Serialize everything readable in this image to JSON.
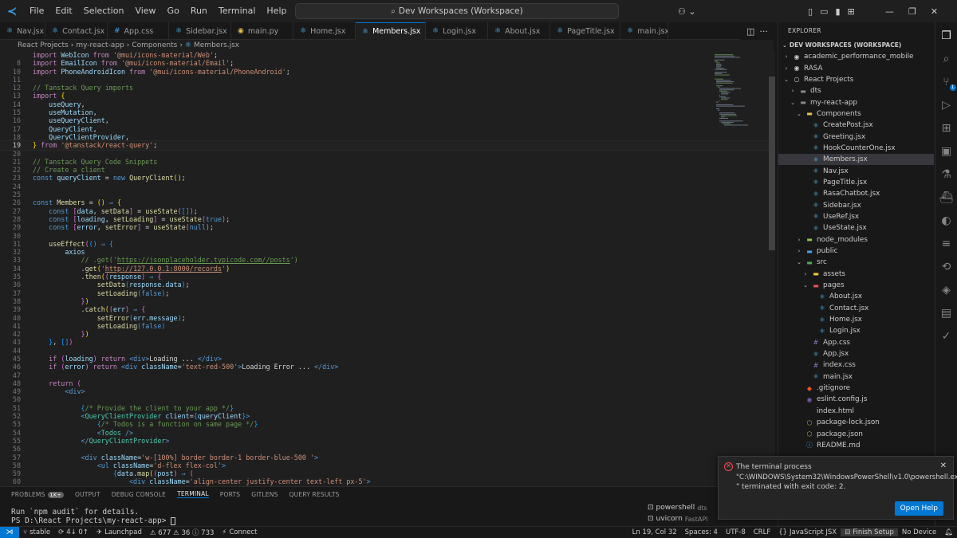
{
  "titlebar": {
    "menus": [
      "File",
      "Edit",
      "Selection",
      "View",
      "Go",
      "Run",
      "Terminal",
      "Help"
    ],
    "command_center": "Dev Workspaces (Workspace)"
  },
  "tabs": [
    {
      "label": "Nav.jsx",
      "icon": "react-icon",
      "active": false
    },
    {
      "label": "Contact.jsx",
      "icon": "react-icon",
      "active": false
    },
    {
      "label": "App.css",
      "icon": "css-icon",
      "active": false
    },
    {
      "label": "Sidebar.jsx",
      "icon": "react-icon",
      "active": false
    },
    {
      "label": "main.py",
      "icon": "python-icon",
      "active": false
    },
    {
      "label": "Home.jsx",
      "icon": "react-icon",
      "active": false
    },
    {
      "label": "Members.jsx",
      "icon": "react-icon",
      "active": true,
      "modified": true
    },
    {
      "label": "Login.jsx",
      "icon": "react-icon",
      "active": false
    },
    {
      "label": "About.jsx",
      "icon": "react-icon",
      "active": false
    },
    {
      "label": "PageTitle.jsx",
      "icon": "react-icon",
      "active": false
    },
    {
      "label": "main.jsx",
      "icon": "react-icon",
      "active": false
    }
  ],
  "breadcrumb": [
    "React Projects",
    "my-react-app",
    "Components",
    "Members.jsx"
  ],
  "editor": {
    "current_line": 19,
    "lines": [
      {
        "n": "",
        "h": "<span class='kw'>import</span> <span class='id'>WebIcon</span> <span class='kw'>from</span> <span class='st'>'@mui/icons-material/Web'</span>;"
      },
      {
        "n": "8",
        "h": "<span class='kw'>import</span> <span class='id'>EmailIcon</span> <span class='kw'>from</span> <span class='st'>'@mui/icons-material/Email'</span>;"
      },
      {
        "n": "10",
        "h": "<span class='kw'>import</span> <span class='id'>PhoneAndroidIcon</span> <span class='kw'>from</span> <span class='st'>'@mui/icons-material/PhoneAndroid'</span>;"
      },
      {
        "n": "11",
        "h": ""
      },
      {
        "n": "12",
        "h": "<span class='cm'>// Tanstack Query imports</span>"
      },
      {
        "n": "13",
        "h": "<span class='kw'>import</span> <span class='br1'>{</span>"
      },
      {
        "n": "14",
        "h": "    <span class='id'>useQuery</span>,"
      },
      {
        "n": "15",
        "h": "    <span class='id'>useMutation</span>,"
      },
      {
        "n": "16",
        "h": "    <span class='id'>useQueryClient</span>,"
      },
      {
        "n": "17",
        "h": "    <span class='id'>QueryClient</span>,"
      },
      {
        "n": "18",
        "h": "    <span class='id'>QueryClientProvider</span>,"
      },
      {
        "n": "19",
        "h": "<span class='br1'>}</span> <span class='kw'>from</span> <span class='st'>'@tanstack/react-query'</span>;"
      },
      {
        "n": "20",
        "h": ""
      },
      {
        "n": "21",
        "h": "<span class='cm'>// Tanstack Query Code Snippets</span>"
      },
      {
        "n": "22",
        "h": "<span class='cm'>// Create a client</span>"
      },
      {
        "n": "23",
        "h": "<span class='kw2'>const</span> <span class='id'>queryClient</span> = <span class='kw2'>new</span> <span class='fn'>QueryClient</span><span class='br1'>()</span>;"
      },
      {
        "n": "24",
        "h": ""
      },
      {
        "n": "25",
        "h": ""
      },
      {
        "n": "26",
        "h": "<span class='kw2'>const</span> <span class='fn'>Members</span> = <span class='br1'>()</span> <span class='kw2'>⇒</span> <span class='br1'>{</span>"
      },
      {
        "n": "27",
        "h": "    <span class='kw2'>const</span> <span class='br2'>[</span><span class='id'>data</span>, <span class='fn'>setData</span><span class='br2'>]</span> = <span class='fn'>useState</span><span class='br2'>(</span><span class='br3'>[]</span><span class='br2'>)</span>;"
      },
      {
        "n": "28",
        "h": "    <span class='kw2'>const</span> <span class='br2'>[</span><span class='id'>loading</span>, <span class='fn'>setLoading</span><span class='br2'>]</span> = <span class='fn'>useState</span><span class='br2'>(</span><span class='kw2'>true</span><span class='br2'>)</span>;"
      },
      {
        "n": "29",
        "h": "    <span class='kw2'>const</span> <span class='br2'>[</span><span class='id'>error</span>, <span class='fn'>setError</span><span class='br2'>]</span> = <span class='fn'>useState</span><span class='br2'>(</span><span class='kw2'>null</span><span class='br2'>)</span>;"
      },
      {
        "n": "30",
        "h": ""
      },
      {
        "n": "31",
        "h": "    <span class='fn'>useEffect</span><span class='br2'>(</span><span class='br3'>()</span> <span class='kw2'>⇒</span> <span class='br3'>{</span>"
      },
      {
        "n": "32",
        "h": "        <span class='id'>axios</span>"
      },
      {
        "n": "33",
        "h": "            <span class='cm'>// .get('<span class='ul'>https://jsonplaceholder.typicode.com//posts</span>')</span>"
      },
      {
        "n": "34",
        "h": "            .<span class='fn'>get</span><span class='br1'>(</span><span class='st'>'<span class='ul'>http://127.0.0.1:8000/records</span>'</span><span class='br1'>)</span>"
      },
      {
        "n": "35",
        "h": "            .<span class='fn'>then</span><span class='br1'>(</span><span class='br2'>(</span><span class='id'>response</span><span class='br2'>)</span> <span class='kw2'>⇒</span> <span class='br2'>{</span>"
      },
      {
        "n": "36",
        "h": "                <span class='fn'>setData</span><span class='br3'>(</span><span class='id'>response</span>.<span class='id'>data</span><span class='br3'>)</span>;"
      },
      {
        "n": "37",
        "h": "                <span class='fn'>setLoading</span><span class='br3'>(</span><span class='kw2'>false</span><span class='br3'>)</span>;"
      },
      {
        "n": "38",
        "h": "            <span class='br2'>}</span><span class='br1'>)</span>"
      },
      {
        "n": "39",
        "h": "            .<span class='fn'>catch</span><span class='br1'>(</span><span class='br2'>(</span><span class='id'>err</span><span class='br2'>)</span> <span class='kw2'>⇒</span> <span class='br2'>{</span>"
      },
      {
        "n": "40",
        "h": "                <span class='fn'>setError</span><span class='br3'>(</span><span class='id'>err</span>.<span class='id'>message</span><span class='br3'>)</span>;"
      },
      {
        "n": "41",
        "h": "                <span class='fn'>setLoading</span><span class='br3'>(</span><span class='kw2'>false</span><span class='br3'>)</span>"
      },
      {
        "n": "42",
        "h": "            <span class='br2'>}</span><span class='br1'>)</span>"
      },
      {
        "n": "43",
        "h": "    <span class='br3'>}</span>, <span class='br3'>[]</span><span class='br2'>)</span>"
      },
      {
        "n": "44",
        "h": ""
      },
      {
        "n": "45",
        "h": "    <span class='kw'>if</span> <span class='br2'>(</span><span class='id'>loading</span><span class='br2'>)</span> <span class='kw'>return</span> <span class='tag'>&lt;div&gt;</span>Loading ... <span class='tag'>&lt;/div&gt;</span>"
      },
      {
        "n": "46",
        "h": "    <span class='kw'>if</span> <span class='br2'>(</span><span class='id'>error</span><span class='br2'>)</span> <span class='kw'>return</span> <span class='tag'>&lt;div</span> <span class='at'>className</span>=<span class='st'>'text-red-500'</span><span class='tag'>&gt;</span>Loading Error ... <span class='tag'>&lt;/div&gt;</span>"
      },
      {
        "n": "47",
        "h": ""
      },
      {
        "n": "48",
        "h": "    <span class='kw'>return</span> <span class='br2'>(</span>"
      },
      {
        "n": "49",
        "h": "        <span class='tag'>&lt;div&gt;</span>"
      },
      {
        "n": "50",
        "h": ""
      },
      {
        "n": "51",
        "h": "            <span class='br3'>{</span><span class='cm'>/* Provide the client to your app */</span><span class='br3'>}</span>"
      },
      {
        "n": "52",
        "h": "            <span class='tag'>&lt;</span><span class='ty'>QueryClientProvider</span> <span class='at'>client</span>=<span class='br3'>{</span><span class='id'>queryClient</span><span class='br3'>}</span><span class='tag'>&gt;</span>"
      },
      {
        "n": "53",
        "h": "                <span class='br3'>{</span><span class='cm'>/* Todos is a function on same page */</span><span class='br3'>}</span>"
      },
      {
        "n": "54",
        "h": "                <span class='tag'>&lt;</span><span class='ty'>Todos</span> <span class='tag'>/&gt;</span>"
      },
      {
        "n": "55",
        "h": "            <span class='tag'>&lt;/</span><span class='ty'>QueryClientProvider</span><span class='tag'>&gt;</span>"
      },
      {
        "n": "56",
        "h": ""
      },
      {
        "n": "57",
        "h": "            <span class='tag'>&lt;div</span> <span class='at'>className</span>=<span class='st'>'w-[100%] border border-1 border-blue-500 '</span><span class='tag'>&gt;</span>"
      },
      {
        "n": "58",
        "h": "                <span class='tag'>&lt;ul</span> <span class='at'>className</span>=<span class='st'>'d-flex flex-col'</span><span class='tag'>&gt;</span>"
      },
      {
        "n": "59",
        "h": "                    <span class='br3'>{</span><span class='id'>data</span>.<span class='fn'>map</span><span class='br1'>(</span><span class='br2'>(</span><span class='id'>post</span><span class='br2'>)</span> <span class='kw2'>⇒</span> <span class='br2'>(</span>"
      },
      {
        "n": "60",
        "h": "                        <span class='tag'>&lt;div</span> <span class='at'>className</span>=<span class='st'>'align-center justify-center text-left px-5'</span><span class='tag'>&gt;</span>"
      }
    ]
  },
  "panel": {
    "tabs": [
      {
        "label": "PROBLEMS",
        "badge": "1K+"
      },
      {
        "label": "OUTPUT"
      },
      {
        "label": "DEBUG CONSOLE"
      },
      {
        "label": "TERMINAL",
        "active": true
      },
      {
        "label": "PORTS"
      },
      {
        "label": "GITLENS"
      },
      {
        "label": "QUERY RESULTS"
      }
    ],
    "terminal_lines": [
      "Run `npm audit` for details.",
      "PS D:\\React Projects\\my-react-app> "
    ],
    "terminals": [
      {
        "name": "powershell",
        "sub": "dts"
      },
      {
        "name": "uvicorn",
        "sub": "FastAPI"
      }
    ]
  },
  "explorer": {
    "header": "EXPLORER",
    "section": "DEV WORKSPACES (WORKSPACE)",
    "rows": [
      {
        "label": "academic_performance_mobile",
        "depth": 0,
        "chev": "›",
        "icon": "◉",
        "color": "#cccccc"
      },
      {
        "label": "RASA",
        "depth": 0,
        "chev": "›",
        "icon": "◉",
        "color": "#cccccc"
      },
      {
        "label": "React Projects",
        "depth": 0,
        "chev": "⌄",
        "icon": "○",
        "color": "#cccccc"
      },
      {
        "label": "dts",
        "depth": 1,
        "chev": "›",
        "icon": "▬",
        "color": "#8a8a8a"
      },
      {
        "label": "my-react-app",
        "depth": 1,
        "chev": "⌄",
        "icon": "▬",
        "color": "#8a8a8a"
      },
      {
        "label": "Components",
        "depth": 2,
        "chev": "⌄",
        "icon": "▬",
        "color": "#e8c34b"
      },
      {
        "label": "CreatePost.jsx",
        "depth": 3,
        "chev": "",
        "icon": "⚛",
        "color": "#4fc1ff"
      },
      {
        "label": "Greeting.jsx",
        "depth": 3,
        "chev": "",
        "icon": "⚛",
        "color": "#4fc1ff"
      },
      {
        "label": "HookCounterOne.jsx",
        "depth": 3,
        "chev": "",
        "icon": "⚛",
        "color": "#4fc1ff"
      },
      {
        "label": "Members.jsx",
        "depth": 3,
        "chev": "",
        "icon": "⚛",
        "color": "#4fc1ff",
        "selected": true
      },
      {
        "label": "Nav.jsx",
        "depth": 3,
        "chev": "",
        "icon": "⚛",
        "color": "#4fc1ff"
      },
      {
        "label": "PageTitle.jsx",
        "depth": 3,
        "chev": "",
        "icon": "⚛",
        "color": "#4fc1ff"
      },
      {
        "label": "RasaChatbot.jsx",
        "depth": 3,
        "chev": "",
        "icon": "⚛",
        "color": "#4fc1ff"
      },
      {
        "label": "Sidebar.jsx",
        "depth": 3,
        "chev": "",
        "icon": "⚛",
        "color": "#4fc1ff"
      },
      {
        "label": "UseRef.jsx",
        "depth": 3,
        "chev": "",
        "icon": "⚛",
        "color": "#4fc1ff"
      },
      {
        "label": "UseState.jsx",
        "depth": 3,
        "chev": "",
        "icon": "⚛",
        "color": "#4fc1ff"
      },
      {
        "label": "node_modules",
        "depth": 2,
        "chev": "›",
        "icon": "▬",
        "color": "#8bc34a"
      },
      {
        "label": "public",
        "depth": 2,
        "chev": "›",
        "icon": "▬",
        "color": "#42a5f5"
      },
      {
        "label": "src",
        "depth": 2,
        "chev": "⌄",
        "icon": "▬",
        "color": "#4caf50"
      },
      {
        "label": "assets",
        "depth": 3,
        "chev": "›",
        "icon": "▬",
        "color": "#ffca28"
      },
      {
        "label": "pages",
        "depth": 3,
        "chev": "⌄",
        "icon": "▬",
        "color": "#ef5350"
      },
      {
        "label": "About.jsx",
        "depth": 4,
        "chev": "",
        "icon": "⚛",
        "color": "#4fc1ff"
      },
      {
        "label": "Contact.jsx",
        "depth": 4,
        "chev": "",
        "icon": "⚛",
        "color": "#4fc1ff"
      },
      {
        "label": "Home.jsx",
        "depth": 4,
        "chev": "",
        "icon": "⚛",
        "color": "#4fc1ff"
      },
      {
        "label": "Login.jsx",
        "depth": 4,
        "chev": "",
        "icon": "⚛",
        "color": "#4fc1ff"
      },
      {
        "label": "App.css",
        "depth": 3,
        "chev": "",
        "icon": "#",
        "color": "#9575cd"
      },
      {
        "label": "App.jsx",
        "depth": 3,
        "chev": "",
        "icon": "⚛",
        "color": "#4fc1ff"
      },
      {
        "label": "index.css",
        "depth": 3,
        "chev": "",
        "icon": "#",
        "color": "#9575cd"
      },
      {
        "label": "main.jsx",
        "depth": 3,
        "chev": "",
        "icon": "⚛",
        "color": "#4fc1ff"
      },
      {
        "label": ".gitignore",
        "depth": 2,
        "chev": "",
        "icon": "◆",
        "color": "#f4511e"
      },
      {
        "label": "eslint.config.js",
        "depth": 2,
        "chev": "",
        "icon": "◉",
        "color": "#7e57c2"
      },
      {
        "label": "index.html",
        "depth": 2,
        "chev": "",
        "icon": "",
        "color": "#cccccc"
      },
      {
        "label": "package-lock.json",
        "depth": 2,
        "chev": "",
        "icon": "⬡",
        "color": "#8bc34a"
      },
      {
        "label": "package.json",
        "depth": 2,
        "chev": "",
        "icon": "⬡",
        "color": "#8bc34a"
      },
      {
        "label": "README.md",
        "depth": 2,
        "chev": "",
        "icon": "ⓘ",
        "color": "#42a5f5"
      }
    ]
  },
  "notification": {
    "title": "The terminal process",
    "path": "\"C:\\WINDOWS\\System32\\WindowsPowerShell\\v1.0\\powershell.exe",
    "detail": "\" terminated with exit code: 2.",
    "button": "Open Help"
  },
  "statusbar": {
    "branch": "stable",
    "sync": "4↓ 0↑",
    "launchpad": "Launchpad",
    "problems": "⚠ 677 ⚠ 36 ⓘ 733",
    "connect": "Connect",
    "position": "Ln 19, Col 32",
    "spaces": "Spaces: 4",
    "encoding": "UTF-8",
    "eol": "CRLF",
    "language": "JavaScript JSX",
    "finish_setup": "Finish Setup",
    "device": "No Device"
  }
}
